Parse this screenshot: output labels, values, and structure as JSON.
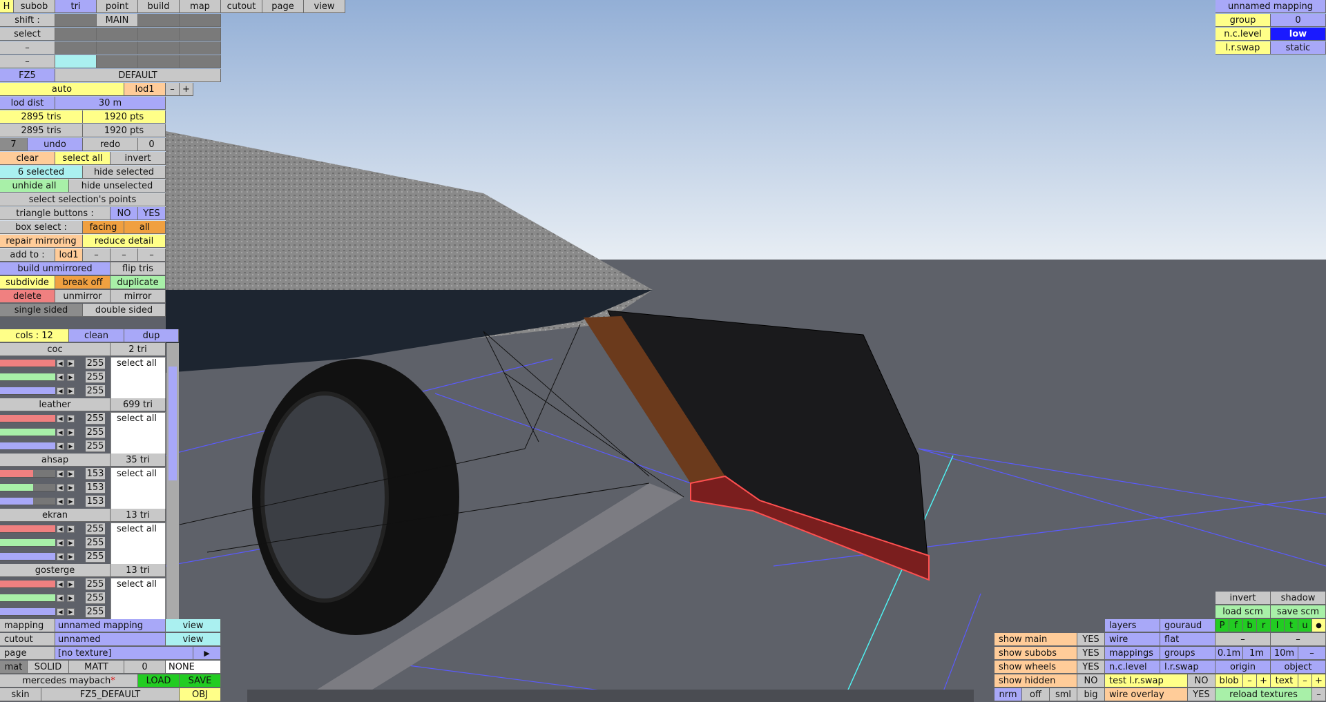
{
  "top_tabs": [
    "H",
    "subob",
    "tri",
    "point",
    "build",
    "map",
    "cutout",
    "page",
    "view"
  ],
  "shift_label": "shift :",
  "main_label": "MAIN",
  "select_label": "select",
  "dash": "–",
  "fz5": "FZ5",
  "default": "DEFAULT",
  "auto": "auto",
  "lod1": "lod1",
  "minus": "–",
  "plus": "+",
  "lod_dist_label": "lod dist",
  "lod_dist_value": "30 m",
  "tris1": "2895 tris",
  "pts1": "1920 pts",
  "tris2": "2895 tris",
  "pts2": "1920 pts",
  "undo_count": "7",
  "undo": "undo",
  "redo": "redo",
  "redo_count": "0",
  "clear": "clear",
  "select_all": "select all",
  "invert": "invert",
  "selected": "6 selected",
  "hide_selected": "hide selected",
  "unhide_all": "unhide all",
  "hide_unselected": "hide unselected",
  "select_points": "select selection's points",
  "triangle_buttons": "triangle buttons :",
  "no": "NO",
  "yes": "YES",
  "box_select": "box select :",
  "facing": "facing",
  "all": "all",
  "repair_mirroring": "repair mirroring",
  "reduce_detail": "reduce detail",
  "add_to": "add to :",
  "build_unmirrored": "build unmirrored",
  "flip_tris": "flip tris",
  "subdivide": "subdivide",
  "break_off": "break off",
  "duplicate": "duplicate",
  "delete": "delete",
  "unmirror": "unmirror",
  "mirror": "mirror",
  "single_sided": "single sided",
  "double_sided": "double sided",
  "cols": "cols : 12",
  "clean": "clean",
  "dup": "dup",
  "colors": [
    {
      "name": "coc",
      "tri": "2 tri",
      "vals": [
        "255",
        "255",
        "255"
      ],
      "sel": "select all"
    },
    {
      "name": "leather",
      "tri": "699 tri",
      "vals": [
        "255",
        "255",
        "255"
      ],
      "sel": "select all"
    },
    {
      "name": "ahsap",
      "tri": "35 tri",
      "vals": [
        "153",
        "153",
        "153"
      ],
      "sel": "select all"
    },
    {
      "name": "ekran",
      "tri": "13 tri",
      "vals": [
        "255",
        "255",
        "255"
      ],
      "sel": "select all"
    },
    {
      "name": "gosterge",
      "tri": "13 tri",
      "vals": [
        "255",
        "255",
        "255"
      ],
      "sel": "select all"
    }
  ],
  "mapping_label": "mapping",
  "mapping_value": "unnamed mapping",
  "view": "view",
  "cutout_label": "cutout",
  "cutout_value": "unnamed",
  "page_label": "page",
  "page_value": "[no texture]",
  "play": "▶",
  "mat": "mat",
  "solid": "SOLID",
  "matt": "MATT",
  "mat_num": "0",
  "none": "NONE",
  "material_name": "mercedes maybach",
  "asterisk": "*",
  "load": "LOAD",
  "save": "SAVE",
  "skin": "skin",
  "skin_value": "FZ5_DEFAULT",
  "obj": "OBJ",
  "tr_title": "unnamed mapping",
  "tr_group": "group",
  "tr_group_val": "0",
  "tr_nclevel": "n.c.level",
  "tr_nclevel_val": "low",
  "tr_lrswap": "l.r.swap",
  "tr_lrswap_val": "static",
  "br": {
    "invert": "invert",
    "shadow": "shadow",
    "load_scm": "load scm",
    "save_scm": "save scm",
    "show_main": "show main",
    "show_subobs": "show subobs",
    "show_wheels": "show wheels",
    "show_hidden": "show hidden",
    "yes": "YES",
    "no": "NO",
    "layers": "layers",
    "gouraud": "gouraud",
    "wire": "wire",
    "flat": "flat",
    "mappings": "mappings",
    "groups": "groups",
    "nclevel": "n.c.level",
    "lrswap": "l.r.swap",
    "test_lrswap": "test l.r.swap",
    "wire_overlay": "wire overlay",
    "pfbrltu": [
      "P",
      "f",
      "b",
      "r",
      "l",
      "t",
      "u"
    ],
    "dot": "●",
    "d01": "0.1m",
    "d1": "1m",
    "d10": "10m",
    "origin": "origin",
    "object": "object",
    "blob": "blob",
    "text": "text",
    "nrm": "nrm",
    "off": "off",
    "sml": "sml",
    "big": "big",
    "reload": "reload textures"
  },
  "colors_ui": {
    "sky_top": "#9fb8d8",
    "sky_bottom": "#e6ecf2",
    "ground": "#5d6068",
    "selection": "#c81e1e"
  }
}
